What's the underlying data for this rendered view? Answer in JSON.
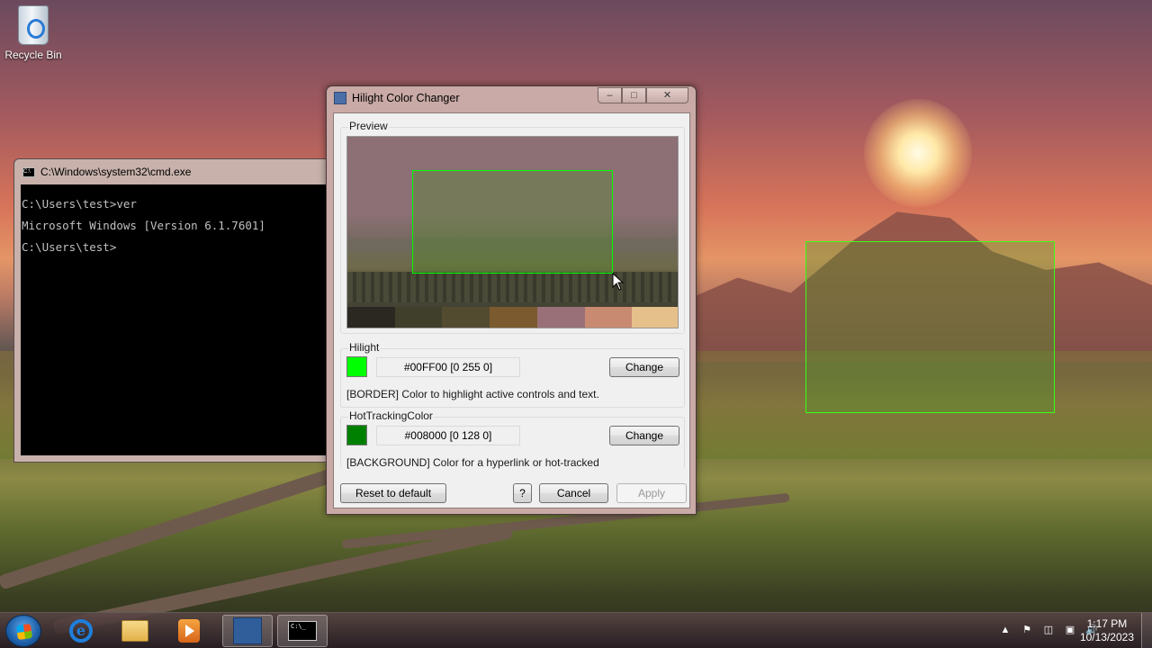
{
  "desktop": {
    "icons": [
      {
        "label": "Recycle Bin",
        "icon": "recycle-bin-icon"
      }
    ]
  },
  "cmd_window": {
    "title": "C:\\Windows\\system32\\cmd.exe",
    "lines": [
      "C:\\Users\\test>ver",
      "Microsoft Windows [Version 6.1.7601]",
      "C:\\Users\\test>"
    ]
  },
  "dialog": {
    "title": "Hilight Color Changer",
    "caption_buttons": {
      "minimize": "–",
      "maximize": "□",
      "close": "✕"
    },
    "preview": {
      "label": "Preview",
      "swatch_colors": [
        "#2b2822",
        "#3f3f2c",
        "#534b30",
        "#7a5a2e",
        "#9a7078",
        "#c98a72",
        "#e6c08a"
      ]
    },
    "hilight": {
      "label": "Hilight",
      "color": "#00FF00",
      "value_text": "#00FF00 [0 255 0]",
      "change_label": "Change",
      "description": "[BORDER] Color to highlight active controls and text."
    },
    "hot_tracking": {
      "label": "HotTrackingColor",
      "color": "#008000",
      "value_text": "#008000 [0 128 0]",
      "change_label": "Change",
      "description": "[BACKGROUND] Color for a hyperlink or hot-tracked"
    },
    "buttons": {
      "reset": "Reset to default",
      "help": "?",
      "cancel": "Cancel",
      "apply": "Apply"
    }
  },
  "taskbar": {
    "pinned": [
      "internet-explorer-icon",
      "file-explorer-icon",
      "media-player-icon",
      "hilight-color-changer-icon",
      "cmd-icon"
    ],
    "clock": {
      "time": "1:17 PM",
      "date": "10/13/2023"
    }
  }
}
